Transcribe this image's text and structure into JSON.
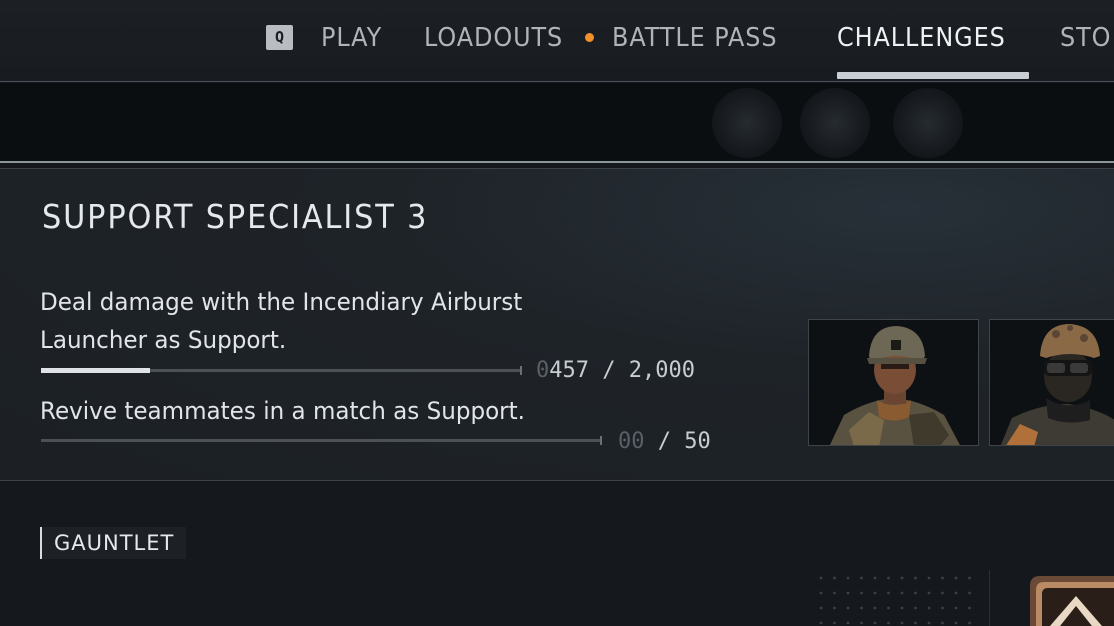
{
  "nav": {
    "key_hint": "Q",
    "items": [
      {
        "label": "PLAY"
      },
      {
        "label": "LOADOUTS"
      },
      {
        "label": "BATTLE PASS"
      },
      {
        "label": "CHALLENGES"
      },
      {
        "label": "STO"
      }
    ],
    "active": "CHALLENGES",
    "notification_color": "#f0902a"
  },
  "card": {
    "title": "SUPPORT SPECIALIST 3",
    "challenges": [
      {
        "line1": "Deal damage with the Incendiary Airburst",
        "line2": "Launcher as Support.",
        "progress_lead": "0",
        "progress_current": "457",
        "progress_sep": " / ",
        "progress_total": "2,000",
        "progress_fraction": 0.2285
      },
      {
        "line1": "Revive teammates in a match as Support.",
        "progress_lead": "00",
        "progress_current": "",
        "progress_sep": " / ",
        "progress_total": "50",
        "progress_fraction": 0
      }
    ],
    "rewards": [
      {
        "icon": "soldier-helmet-portrait-icon"
      },
      {
        "icon": "soldier-goggles-portrait-icon"
      }
    ]
  },
  "section": {
    "label": "GAUNTLET"
  }
}
